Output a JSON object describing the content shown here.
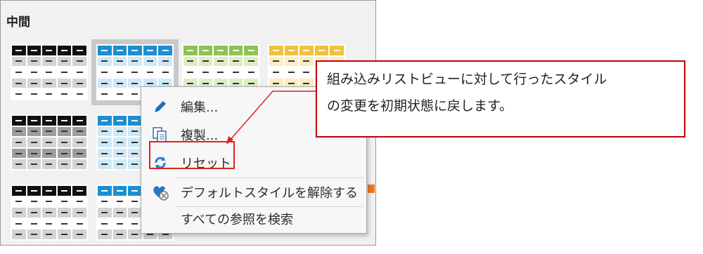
{
  "section": {
    "title": "中間"
  },
  "colors": {
    "black": "#111111",
    "blue": "#1b8fd2",
    "green": "#8fc351",
    "yellow": "#f0c23a",
    "orange": "#ee7a21",
    "gray_row": "#d3d3d3",
    "dark_gray_row": "#9e9e9e",
    "light_blue_row": "#cfe8f8",
    "light_green_row": "#dcedc4",
    "light_yellow_row": "#fbedc2",
    "accent_red": "#e02020"
  },
  "menu": {
    "items": [
      {
        "label": "編集...",
        "icon": "pencil-icon"
      },
      {
        "label": "複製...",
        "icon": "duplicate-icon"
      },
      {
        "label": "リセット",
        "icon": "reset-icon"
      },
      {
        "label": "デフォルトスタイルを解除する",
        "icon": "clear-default-icon"
      },
      {
        "label": "すべての参照を検索",
        "icon": ""
      }
    ]
  },
  "callout": {
    "line1": "組み込みリストビューに対して行ったスタイル",
    "line2": "の変更を初期状態に戻します。"
  }
}
